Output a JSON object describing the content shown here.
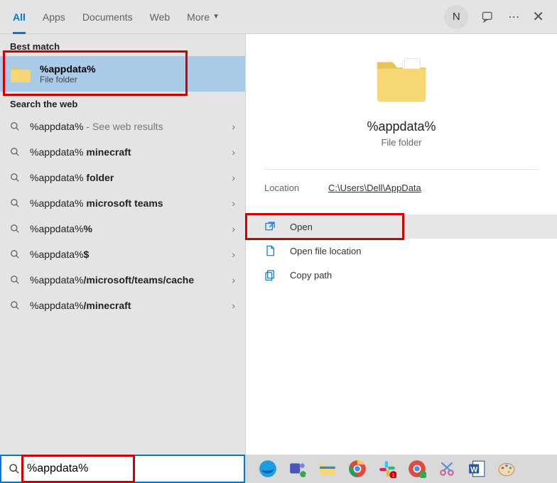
{
  "tabs": {
    "all": "All",
    "apps": "Apps",
    "documents": "Documents",
    "web": "Web",
    "more": "More"
  },
  "user_initial": "N",
  "sections": {
    "best_match": "Best match",
    "search_web": "Search the web"
  },
  "best_match": {
    "title": "%appdata%",
    "subtitle": "File folder"
  },
  "suggestions": [
    {
      "prefix": "%appdata%",
      "bold": "",
      "hint": " - See web results"
    },
    {
      "prefix": "%appdata%",
      "bold": " minecraft",
      "hint": ""
    },
    {
      "prefix": "%appdata%",
      "bold": " folder",
      "hint": ""
    },
    {
      "prefix": "%appdata%",
      "bold": " microsoft teams",
      "hint": ""
    },
    {
      "prefix": "%appdata%",
      "bold": "%",
      "hint": ""
    },
    {
      "prefix": "%appdata%",
      "bold": "$",
      "hint": ""
    },
    {
      "prefix": "%appdata%",
      "bold": "/microsoft/teams/cache",
      "hint": ""
    },
    {
      "prefix": "%appdata%",
      "bold": "/minecraft",
      "hint": ""
    }
  ],
  "preview": {
    "title": "%appdata%",
    "subtitle": "File folder",
    "location_label": "Location",
    "location_value": "C:\\Users\\Dell\\AppData"
  },
  "actions": {
    "open": "Open",
    "open_file_location": "Open file location",
    "copy_path": "Copy path"
  },
  "search_value": "%appdata%"
}
